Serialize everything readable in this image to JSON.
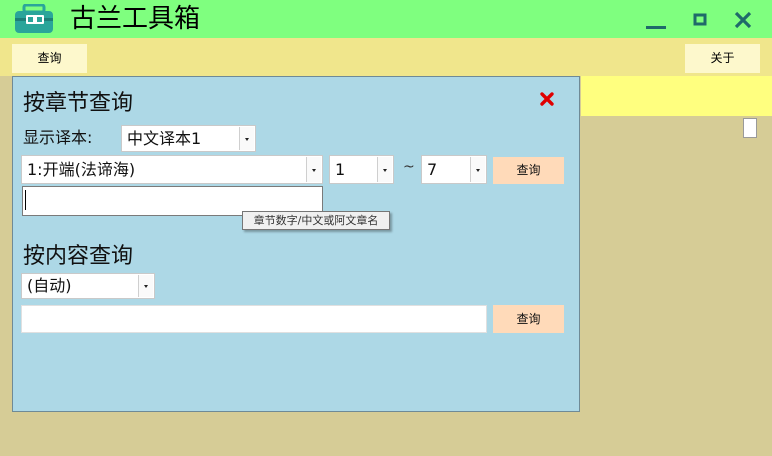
{
  "window": {
    "title": "古兰工具箱",
    "icon": "toolbox-icon",
    "controls": [
      "minimize-icon",
      "maximize-icon",
      "close-icon"
    ],
    "titlebar_color": "#7fff7f"
  },
  "toolbar": {
    "query_label": "查询",
    "about_label": "关于"
  },
  "chapter_query": {
    "title": "按章节查询",
    "translation_label": "显示译本:",
    "translation_selected": "中文译本1",
    "chapter_selected": "1:开端(法谛海)",
    "verse_from": "1",
    "tilde": "~",
    "verse_to": "7",
    "query_label": "查询",
    "chapter_input_value": "",
    "chapter_input_tooltip": "章节数字/中文或阿文章名"
  },
  "content_query": {
    "title": "按内容查询",
    "mode_selected": "(自动)",
    "content_input_value": "",
    "query_label": "查询"
  },
  "colors": {
    "panel": "#add8e6",
    "toolbar": "#f0e68c",
    "query_button": "#ffdab9",
    "background": "#d6cc96"
  }
}
